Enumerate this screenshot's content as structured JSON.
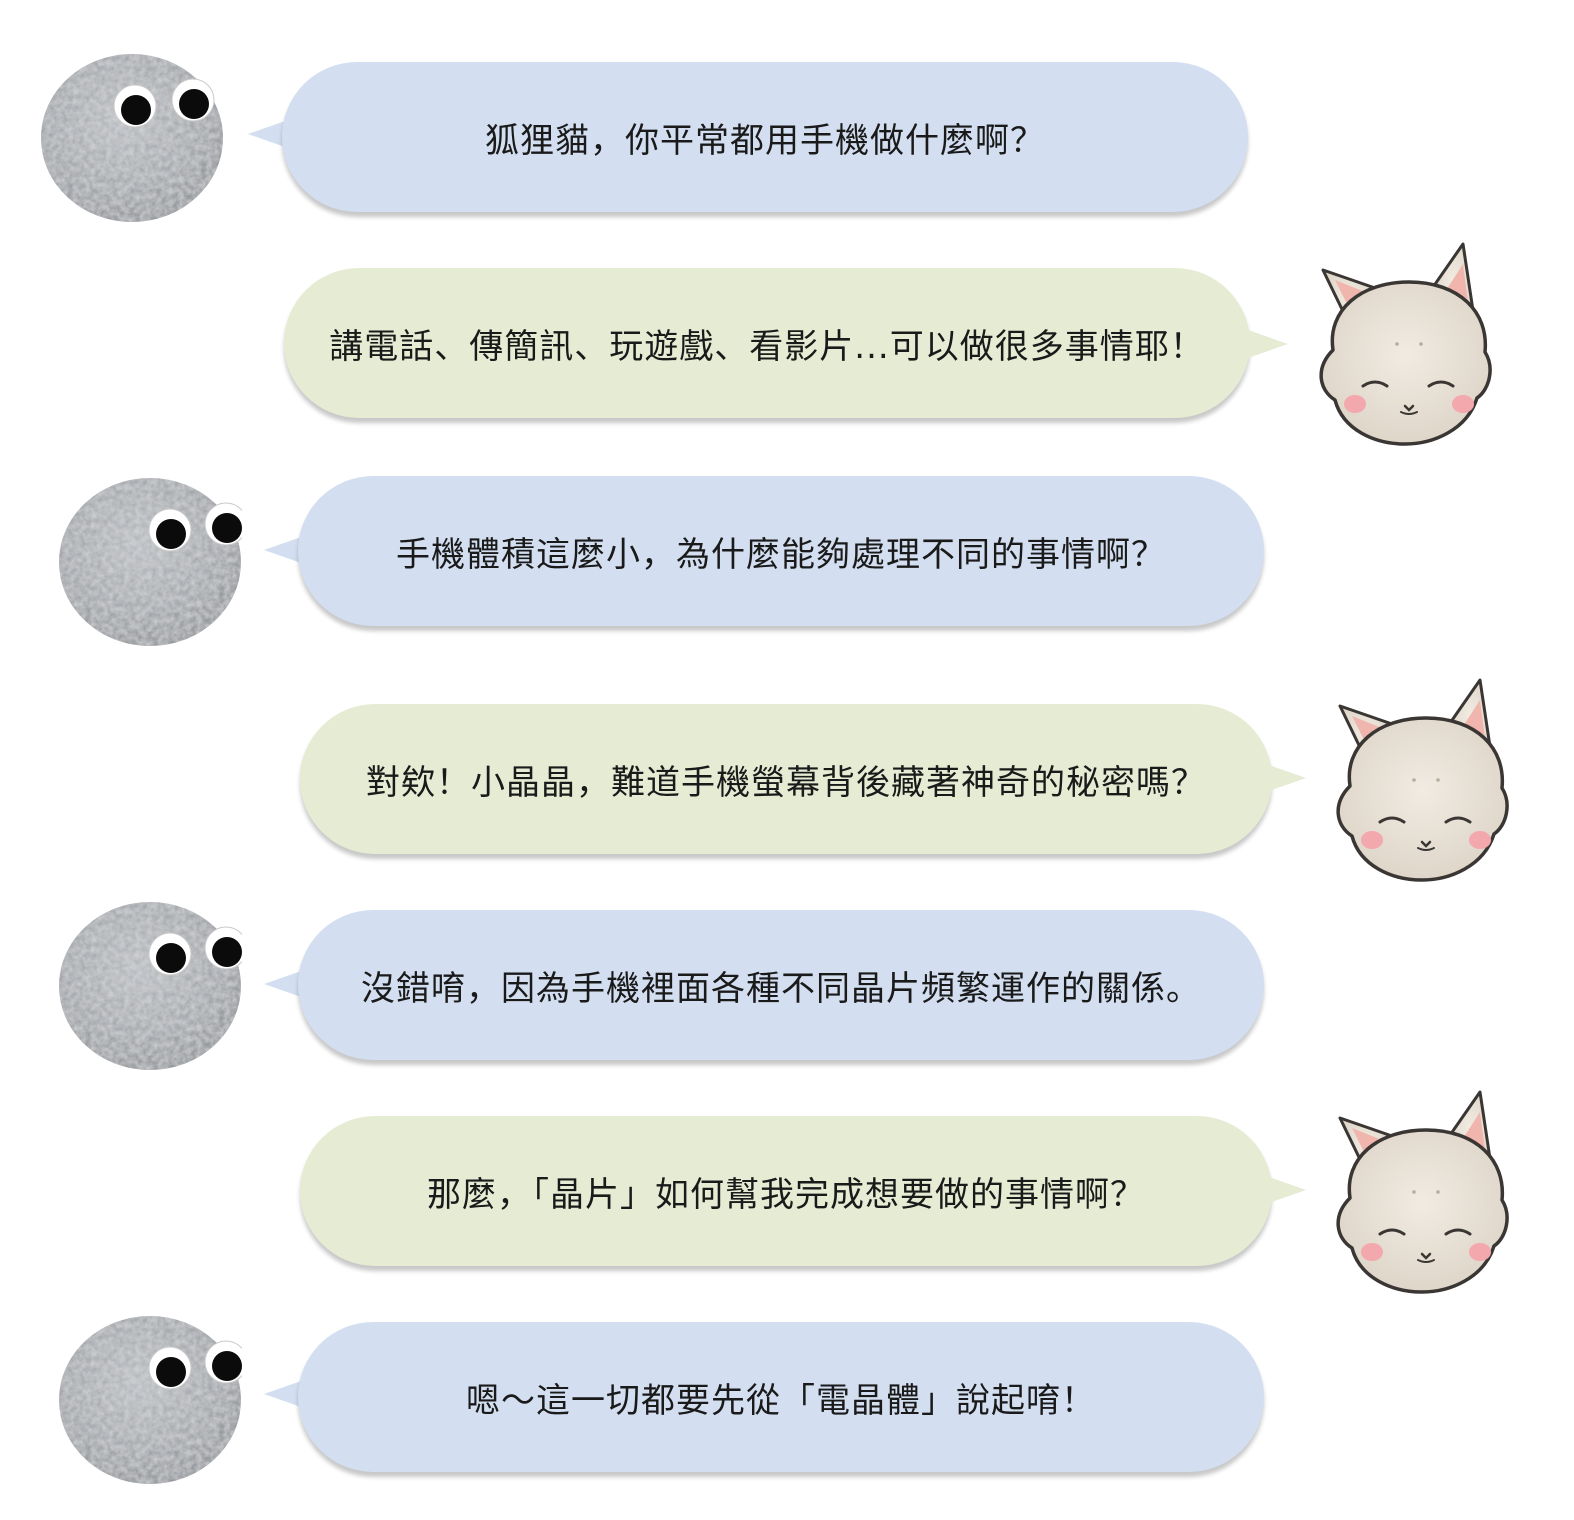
{
  "colors": {
    "rock_bubble": "#d3dff0",
    "cat_bubble": "#e6ecd4",
    "text": "#1a1a1a",
    "cat_fur": "#e8e1d6",
    "cat_outline": "#3a3633",
    "cat_blush": "#f2a8ad",
    "cat_ear_inner": "#f0b6ae",
    "rock_fill": "#a6a9ad"
  },
  "characters": {
    "rock": {
      "icon": "googly-eyed-rock-avatar"
    },
    "cat": {
      "icon": "sleepy-fox-cat-avatar"
    }
  },
  "messages": [
    {
      "speaker": "rock",
      "text": "狐狸貓，你平常都用手機做什麼啊？"
    },
    {
      "speaker": "cat",
      "text": "講電話、傳簡訊、玩遊戲、看影片...可以做很多事情耶！"
    },
    {
      "speaker": "rock",
      "text": "手機體積這麼小，為什麼能夠處理不同的事情啊？"
    },
    {
      "speaker": "cat",
      "text": "對欸！小晶晶，難道手機螢幕背後藏著神奇的秘密嗎？"
    },
    {
      "speaker": "rock",
      "text": "沒錯唷，因為手機裡面各種不同晶片頻繁運作的關係。"
    },
    {
      "speaker": "cat",
      "text": "那麼，「晶片」如何幫我完成想要做的事情啊？"
    },
    {
      "speaker": "rock",
      "text": "嗯～這一切都要先從「電晶體」說起唷！"
    }
  ]
}
